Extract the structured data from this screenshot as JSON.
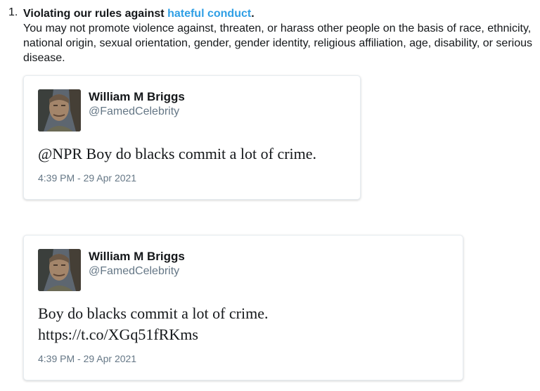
{
  "rule": {
    "number": "1.",
    "title_prefix": "Violating our rules against ",
    "title_link": "hateful conduct",
    "title_suffix": ".",
    "description": "You may not promote violence against, threaten, or harass other people on the basis of race, ethnicity, national origin, sexual orientation, gender, gender identity, religious affiliation, age, disability, or serious disease.",
    "link_color": "#2f9fe5"
  },
  "tweets": [
    {
      "display_name": "William M Briggs",
      "handle": "@FamedCelebrity",
      "text": "@NPR Boy do blacks commit a lot of crime.",
      "timestamp": "4:39 PM - 29 Apr 2021",
      "avatar_icon": "profile-photo"
    },
    {
      "display_name": "William M Briggs",
      "handle": "@FamedCelebrity",
      "text": "Boy do blacks commit a lot of crime.\nhttps://t.co/XGq51fRKms",
      "timestamp": "4:39 PM - 29 Apr 2021",
      "avatar_icon": "profile-photo"
    }
  ]
}
